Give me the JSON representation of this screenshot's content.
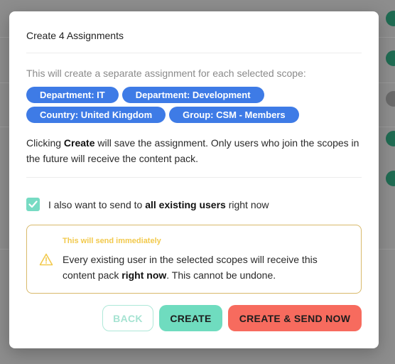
{
  "modal": {
    "title": "Create 4 Assignments",
    "intro": "This will create a separate assignment for each selected scope:",
    "scopes_row1": [
      "Department: IT",
      "Department: Development"
    ],
    "scopes_row2": [
      "Country: United Kingdom",
      "Group: CSM - Members"
    ],
    "note": {
      "part1": "Clicking ",
      "bold": "Create",
      "part2": " will save the assignment. Only users who join the scopes in the future will receive the content pack."
    },
    "send_existing": {
      "checked": true,
      "part1": "I also want to send to ",
      "bold": "all existing users",
      "part2": " right now"
    },
    "warning": {
      "title": "This will send immediately",
      "part1": "Every existing user in the selected scopes will receive this content pack ",
      "bold": "right now",
      "part2": ". This cannot be undone.",
      "icon": "warning-triangle-icon"
    },
    "buttons": {
      "back": "BACK",
      "create": "CREATE",
      "create_send": "CREATE & SEND NOW"
    }
  },
  "colors": {
    "chip": "#3e7be6",
    "accent_green": "#6fdcbf",
    "danger": "#f76b5e",
    "warning": "#f2c94c"
  }
}
